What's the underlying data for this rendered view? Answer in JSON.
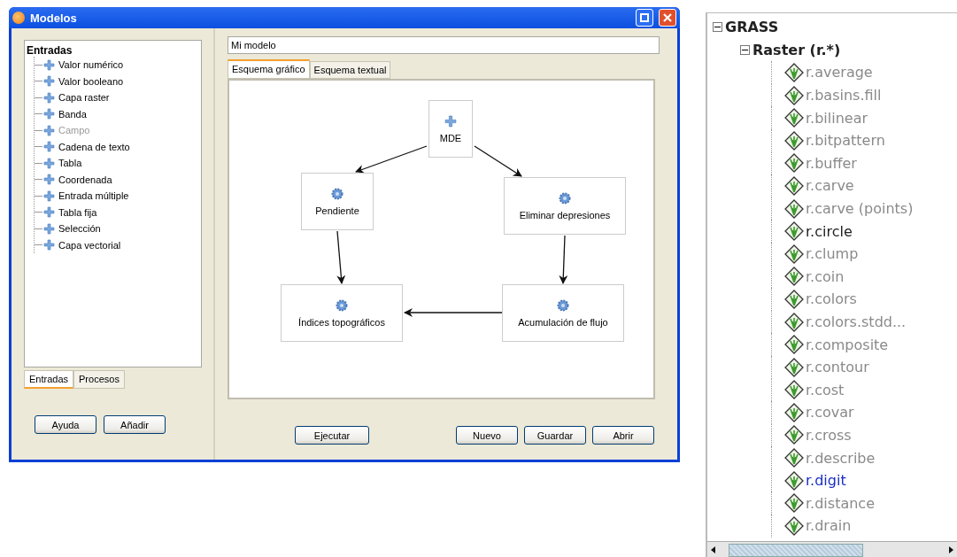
{
  "window": {
    "title": "Modelos"
  },
  "left_panel": {
    "tree": {
      "label": "Entradas",
      "children": [
        {
          "label": "Valor numérico",
          "disabled": false
        },
        {
          "label": "Valor booleano",
          "disabled": false
        },
        {
          "label": "Capa raster",
          "disabled": false
        },
        {
          "label": "Banda",
          "disabled": false
        },
        {
          "label": "Campo",
          "disabled": true
        },
        {
          "label": "Cadena de texto",
          "disabled": false
        },
        {
          "label": "Tabla",
          "disabled": false
        },
        {
          "label": "Coordenada",
          "disabled": false
        },
        {
          "label": "Entrada múltiple",
          "disabled": false
        },
        {
          "label": "Tabla fija",
          "disabled": false
        },
        {
          "label": "Selección",
          "disabled": false
        },
        {
          "label": "Capa vectorial",
          "disabled": false
        }
      ]
    },
    "tabs": [
      {
        "label": "Entradas",
        "selected": true
      },
      {
        "label": "Procesos",
        "selected": false
      }
    ],
    "buttons": [
      "Ayuda",
      "Añadir"
    ]
  },
  "model_name": {
    "value": "Mi modelo"
  },
  "tabs": [
    {
      "label": "Esquema gráfico",
      "selected": true
    },
    {
      "label": "Esquema textual",
      "selected": false
    }
  ],
  "diagram": {
    "nodes": [
      {
        "label": "MDE",
        "kind": "input"
      },
      {
        "label": "Pendiente",
        "kind": "process"
      },
      {
        "label": "Eliminar depresiones",
        "kind": "process"
      },
      {
        "label": "Índices topográficos",
        "kind": "process"
      },
      {
        "label": "Acumulación de flujo",
        "kind": "process"
      }
    ]
  },
  "buttons_left": [
    "Ejecutar"
  ],
  "buttons_right": [
    "Nuevo",
    "Guardar",
    "Abrir"
  ],
  "toolbox_tree": {
    "label": "GRASS",
    "expanded": true,
    "children": [
      {
        "label": "Raster (r.*)",
        "expanded": true,
        "children": [
          {
            "label": "r.average",
            "disabled": true,
            "selected": false
          },
          {
            "label": "r.basins.fill",
            "disabled": true,
            "selected": false
          },
          {
            "label": "r.bilinear",
            "disabled": true,
            "selected": false
          },
          {
            "label": "r.bitpattern",
            "disabled": true,
            "selected": false
          },
          {
            "label": "r.buffer",
            "disabled": true,
            "selected": false
          },
          {
            "label": "r.carve",
            "disabled": true,
            "selected": false
          },
          {
            "label": "r.carve (points)",
            "disabled": true,
            "selected": false
          },
          {
            "label": "r.circle",
            "disabled": false,
            "selected": false
          },
          {
            "label": "r.clump",
            "disabled": true,
            "selected": false
          },
          {
            "label": "r.coin",
            "disabled": true,
            "selected": false
          },
          {
            "label": "r.colors",
            "disabled": true,
            "selected": false
          },
          {
            "label": "r.colors.stdd...",
            "disabled": true,
            "selected": false
          },
          {
            "label": "r.composite",
            "disabled": true,
            "selected": false
          },
          {
            "label": "r.contour",
            "disabled": true,
            "selected": false
          },
          {
            "label": "r.cost",
            "disabled": true,
            "selected": false
          },
          {
            "label": "r.covar",
            "disabled": true,
            "selected": false
          },
          {
            "label": "r.cross",
            "disabled": true,
            "selected": false
          },
          {
            "label": "r.describe",
            "disabled": true,
            "selected": false
          },
          {
            "label": "r.digit",
            "disabled": false,
            "selected": true
          },
          {
            "label": "r.distance",
            "disabled": true,
            "selected": false
          },
          {
            "label": "r.drain",
            "disabled": true,
            "selected": false
          }
        ]
      }
    ]
  }
}
